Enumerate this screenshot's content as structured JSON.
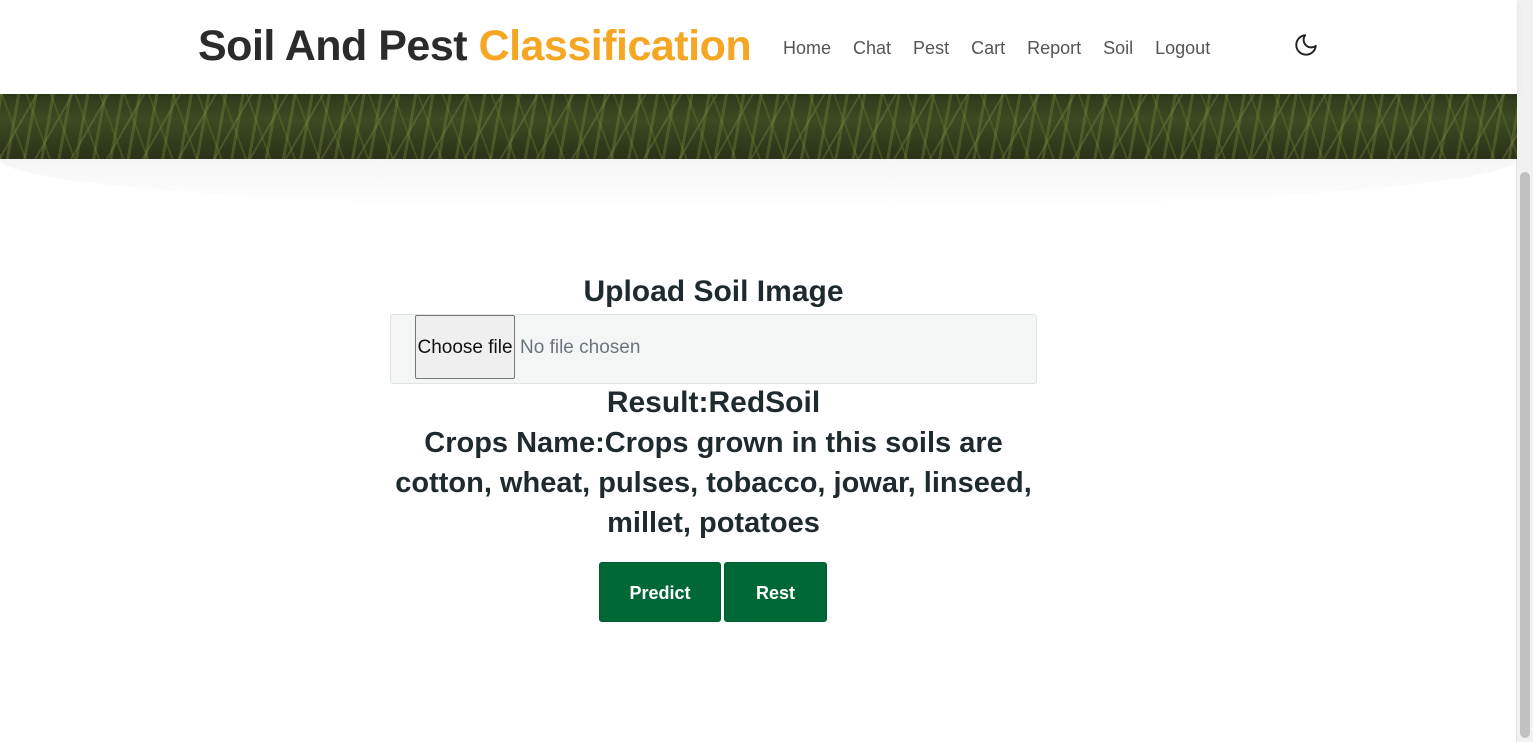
{
  "header": {
    "brand_main": "Soil And Pest",
    "brand_accent": "Classification",
    "nav": [
      {
        "label": "Home"
      },
      {
        "label": "Chat"
      },
      {
        "label": "Pest"
      },
      {
        "label": "Cart"
      },
      {
        "label": "Report"
      },
      {
        "label": "Soil"
      },
      {
        "label": "Logout"
      }
    ],
    "theme_toggle_icon": "moon-icon"
  },
  "upload": {
    "title": "Upload Soil Image",
    "choose_file_label": "Choose file",
    "file_status": "No file chosen"
  },
  "result": {
    "label": "Result:RedSoil",
    "crops": "Crops Name:Crops grown in this soils are cotton, wheat, pulses, tobacco, jowar, linseed, millet, potatoes"
  },
  "actions": {
    "predict_label": "Predict",
    "reset_label": "Rest"
  },
  "colors": {
    "brand_accent": "#f5a623",
    "button_green": "#006837"
  }
}
